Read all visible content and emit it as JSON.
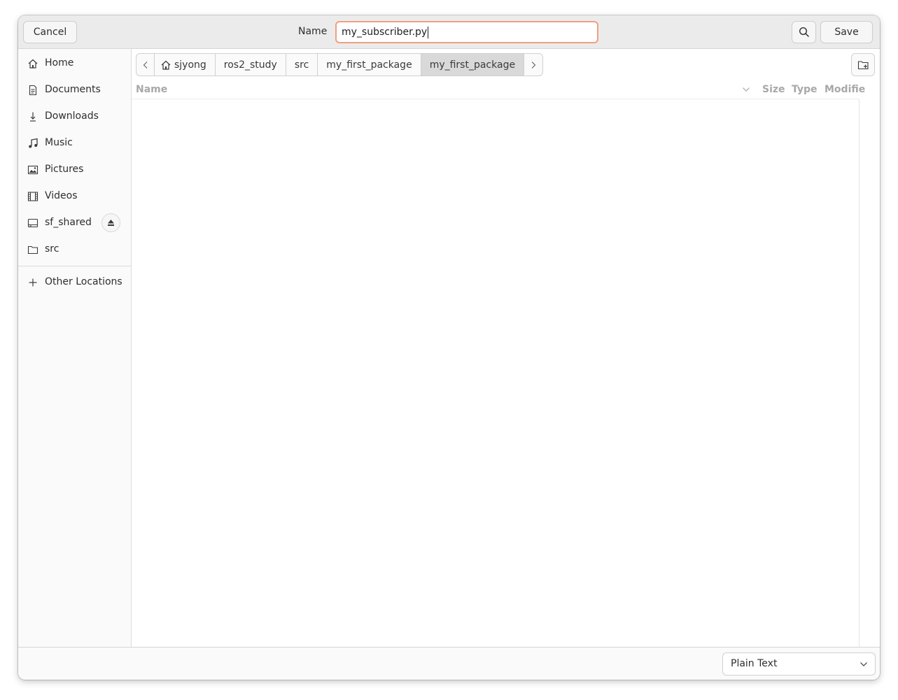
{
  "header": {
    "cancel_label": "Cancel",
    "name_label": "Name",
    "filename_value": "my_subscriber.py",
    "save_label": "Save"
  },
  "sidebar": {
    "items": [
      {
        "label": "Home",
        "icon": "home-icon"
      },
      {
        "label": "Documents",
        "icon": "documents-icon"
      },
      {
        "label": "Downloads",
        "icon": "downloads-icon"
      },
      {
        "label": "Music",
        "icon": "music-icon"
      },
      {
        "label": "Pictures",
        "icon": "pictures-icon"
      },
      {
        "label": "Videos",
        "icon": "videos-icon"
      },
      {
        "label": "sf_shared",
        "icon": "drive-icon"
      },
      {
        "label": "src",
        "icon": "folder-icon"
      }
    ],
    "other_locations": "Other Locations"
  },
  "pathbar": {
    "crumbs": [
      "sjyong",
      "ros2_study",
      "src",
      "my_first_package",
      "my_first_package"
    ]
  },
  "list": {
    "columns": [
      "Name",
      "Size",
      "Type",
      "Modifie"
    ]
  },
  "footer": {
    "filter_value": "Plain Text"
  },
  "colors": {
    "focus_border": "#f0a080",
    "active_crumb": "#d9d9d9"
  }
}
